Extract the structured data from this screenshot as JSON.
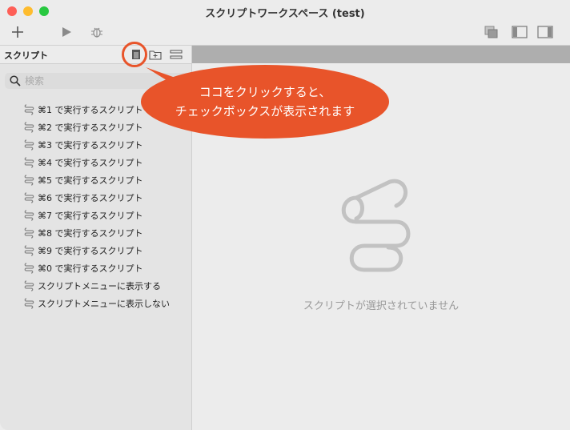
{
  "window": {
    "title": "スクリプトワークスペース (test)"
  },
  "toolbar": {
    "add_icon": "plus-icon",
    "run_icon": "play-icon",
    "debug_icon": "bug-icon",
    "right_icons": [
      "stack-icon",
      "sidebar-left-icon",
      "sidebar-right-icon"
    ]
  },
  "sidebar": {
    "title": "スクリプト",
    "search_placeholder": "検索",
    "items": [
      "⌘1 で実行するスクリプト",
      "⌘2 で実行するスクリプト",
      "⌘3 で実行するスクリプト",
      "⌘4 で実行するスクリプト",
      "⌘5 で実行するスクリプト",
      "⌘6 で実行するスクリプト",
      "⌘7 で実行するスクリプト",
      "⌘8 で実行するスクリプト",
      "⌘9 で実行するスクリプト",
      "⌘0 で実行するスクリプト",
      "スクリプトメニューに表示する",
      "スクリプトメニューに表示しない"
    ]
  },
  "main": {
    "empty_message": "スクリプトが選択されていません"
  },
  "callout": {
    "line1": "ココをクリックすると、",
    "line2": "チェックボックスが表示されます",
    "color": "#e8542a"
  }
}
